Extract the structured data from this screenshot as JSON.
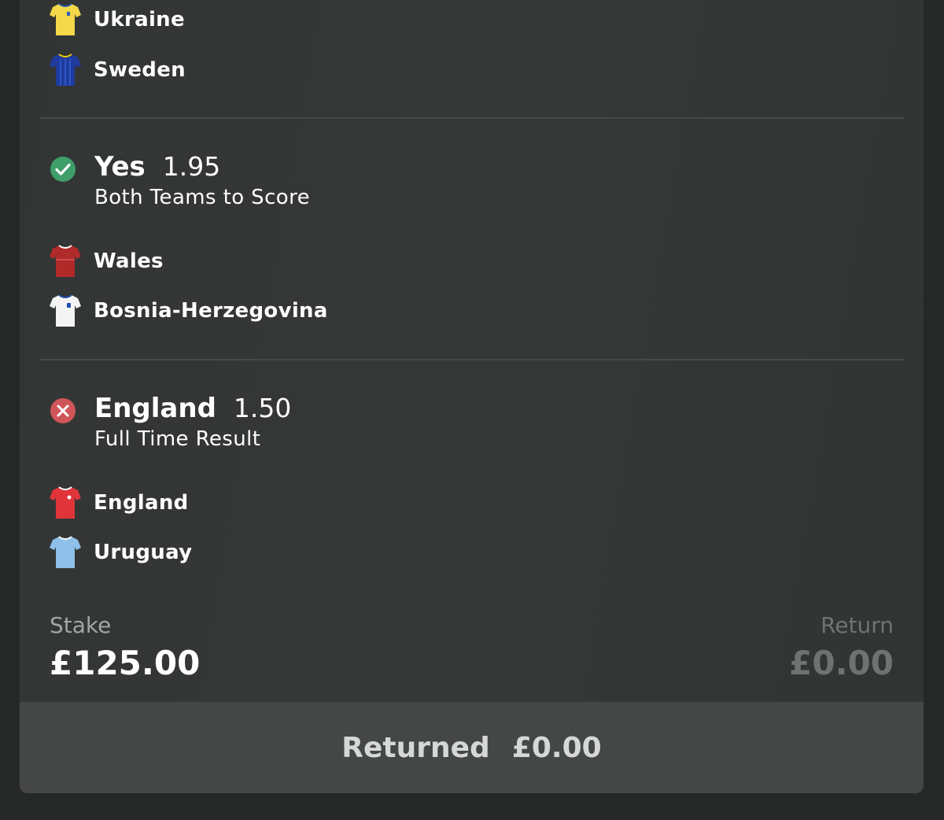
{
  "legs": [
    {
      "teams": [
        {
          "name": "Ukraine",
          "icon": "shirt-yellow-icon",
          "color": "#f4d84a",
          "trim": "#2a5db0"
        },
        {
          "name": "Sweden",
          "icon": "shirt-blue-icon",
          "color": "#1f3b9c",
          "trim": "#f0d000"
        }
      ]
    },
    {
      "status": "won",
      "selection": "Yes",
      "odds": "1.95",
      "market": "Both Teams to Score",
      "teams": [
        {
          "name": "Wales",
          "icon": "shirt-red-icon",
          "color": "#b02a2a",
          "trim": "#ffffff"
        },
        {
          "name": "Bosnia-Herzegovina",
          "icon": "shirt-white-icon",
          "color": "#f4f4f4",
          "trim": "#1e4fb0"
        }
      ]
    },
    {
      "status": "lost",
      "selection": "England",
      "odds": "1.50",
      "market": "Full Time Result",
      "teams": [
        {
          "name": "England",
          "icon": "shirt-red-icon",
          "color": "#e0343a",
          "trim": "#ffffff"
        },
        {
          "name": "Uruguay",
          "icon": "shirt-lightblue-icon",
          "color": "#8ec0ea",
          "trim": "#ffffff"
        }
      ]
    }
  ],
  "stake": {
    "label": "Stake",
    "value": "£125.00"
  },
  "return": {
    "label": "Return",
    "value": "£0.00"
  },
  "returned": {
    "label": "Returned",
    "value": "£0.00"
  },
  "colors": {
    "won": "#3f9e6a",
    "lost": "#d0555a",
    "background": "#262827",
    "card": "#343736"
  }
}
